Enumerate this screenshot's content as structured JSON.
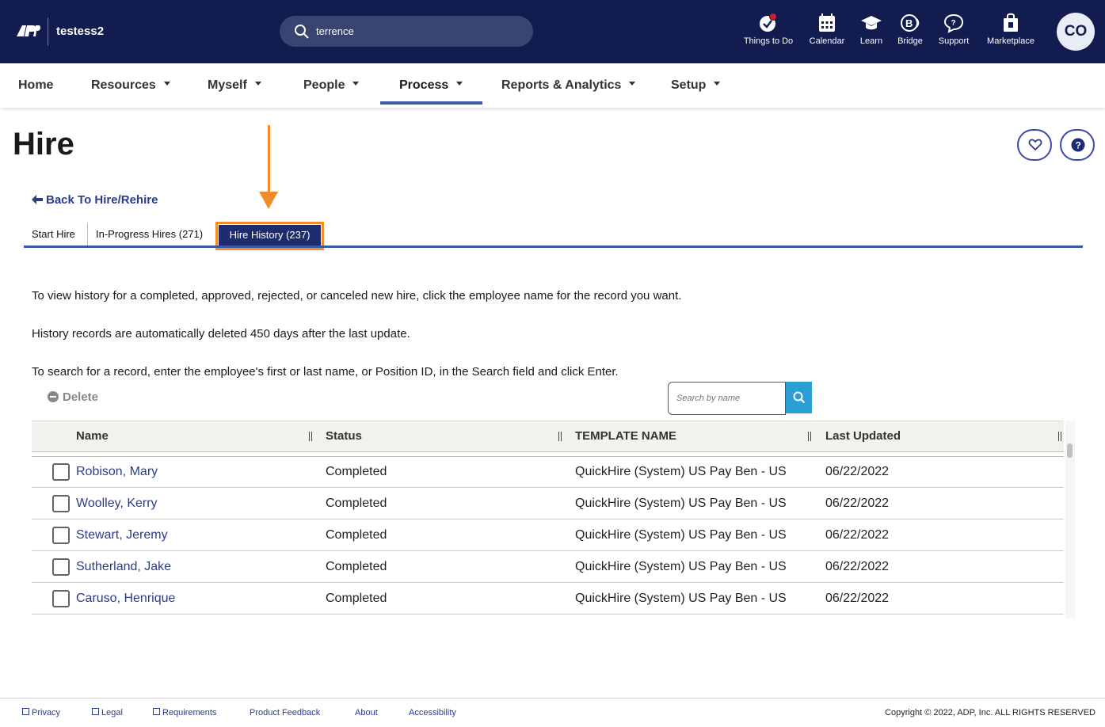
{
  "header": {
    "company": "testess2",
    "search_value": "terrence",
    "nav_icons": [
      {
        "label": "Things to Do",
        "icon": "checklist-icon"
      },
      {
        "label": "Calendar",
        "icon": "calendar-icon"
      },
      {
        "label": "Learn",
        "icon": "graduation-cap-icon"
      },
      {
        "label": "Bridge",
        "icon": "bridge-icon"
      },
      {
        "label": "Support",
        "icon": "chat-help-icon"
      },
      {
        "label": "Marketplace",
        "icon": "shopping-bag-icon"
      }
    ],
    "avatar_initials": "CO"
  },
  "mainnav": {
    "items": [
      "Home",
      "Resources",
      "Myself",
      "People",
      "Process",
      "Reports & Analytics",
      "Setup"
    ],
    "active": "Process"
  },
  "page": {
    "title": "Hire",
    "back_link": "Back To Hire/Rehire",
    "tabs": [
      "Start Hire",
      "In-Progress Hires (271)",
      "Hire History (237)"
    ],
    "active_tab": "Hire History (237)",
    "para1": "To view history for a completed, approved, rejected, or canceled new hire, click the employee name for the record you want.",
    "para2": "History records are automatically deleted 450 days after the last update.",
    "para3": "To search for a record, enter the employee's first or last name, or Position ID, in the Search field and click Enter.",
    "delete_label": "Delete",
    "search_placeholder": "Search by name"
  },
  "table": {
    "columns": [
      "Name",
      "Status",
      "TEMPLATE NAME",
      "Last Updated"
    ],
    "rows": [
      {
        "name": "Robison, Mary",
        "status": "Completed",
        "template": "QuickHire (System) US Pay Ben - US",
        "updated": "06/22/2022"
      },
      {
        "name": "Woolley, Kerry",
        "status": "Completed",
        "template": "QuickHire (System) US Pay Ben - US",
        "updated": "06/22/2022"
      },
      {
        "name": "Stewart, Jeremy",
        "status": "Completed",
        "template": "QuickHire (System) US Pay Ben - US",
        "updated": "06/22/2022"
      },
      {
        "name": "Sutherland, Jake",
        "status": "Completed",
        "template": "QuickHire (System) US Pay Ben - US",
        "updated": "06/22/2022"
      },
      {
        "name": "Caruso, Henrique",
        "status": "Completed",
        "template": "QuickHire (System) US Pay Ben - US",
        "updated": "06/22/2022"
      }
    ]
  },
  "footer": {
    "links": [
      "Privacy",
      "Legal",
      "Requirements",
      "Product Feedback",
      "About",
      "Accessibility"
    ],
    "copyright": "Copyright © 2022, ADP, Inc. ALL RIGHTS RESERVED"
  },
  "colors": {
    "header_bg": "#121c4e",
    "accent": "#3a5aa8",
    "highlight": "#f28c28",
    "link": "#2a3c8c"
  }
}
